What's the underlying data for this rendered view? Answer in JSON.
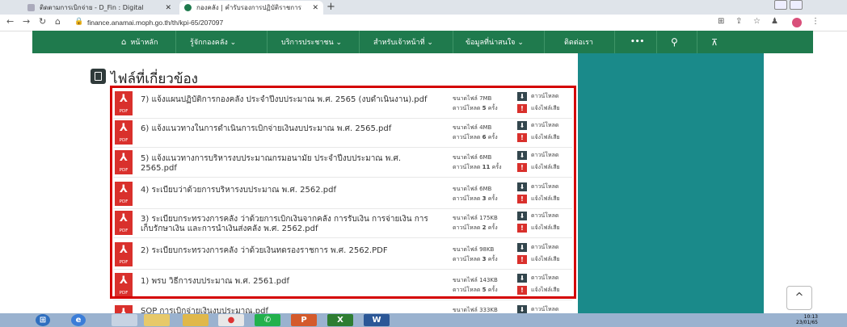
{
  "browser": {
    "tabs": [
      {
        "title": "ติดตามการเบิกจ่าย - D_Fin : Digital"
      },
      {
        "title": "กองคลัง | คำรับรองการปฏิบัติราชการ"
      }
    ],
    "new_tab": "+",
    "url": "finance.anamai.moph.go.th/th/kpi-65/207097"
  },
  "nav": {
    "items": [
      {
        "label": "หน้าหลัก",
        "icon": "home-icon"
      },
      {
        "label": "รู้จักกองคลัง ⌄"
      },
      {
        "label": "บริการประชาชน ⌄"
      },
      {
        "label": "สำหรับเจ้าหน้าที่ ⌄"
      },
      {
        "label": "ข้อมูลที่น่าสนใจ ⌄"
      },
      {
        "label": "ติดต่อเรา"
      }
    ],
    "more": "•••"
  },
  "section": {
    "title": "ไฟล์ที่เกี่ยวข้อง"
  },
  "file_labels": {
    "pdf": "PDF",
    "size_prefix": "ขนาดไฟล์",
    "downloads_prefix": "ดาวน์โหลด",
    "downloads_suffix": "ครั้ง",
    "download": "ดาวน์โหลด",
    "report": "แจ้งไฟล์เสีย"
  },
  "files": [
    {
      "title": "7) แจ้งแผนปฏิบัติการกองคลัง ประจำปีงบประมาณ พ.ศ. 2565 (งบดำเนินงาน).pdf",
      "size": "7MB",
      "downloads": "5"
    },
    {
      "title": "6) แจ้งแนวทางในการดำเนินการเบิกจ่ายเงินงบประมาณ พ.ศ. 2565.pdf",
      "size": "4MB",
      "downloads": "6"
    },
    {
      "title": "5) แจ้งแนวทางการบริหารงบประมาณกรมอนามัย ประจำปีงบประมาณ พ.ศ. 2565.pdf",
      "size": "6MB",
      "downloads": "11"
    },
    {
      "title": "4) ระเบียบว่าด้วยการบริหารงบประมาณ พ.ศ. 2562.pdf",
      "size": "6MB",
      "downloads": "3"
    },
    {
      "title": "3) ระเบียบกระทรวงการคลัง ว่าด้วยการเบิกเงินจากคลัง การรับเงิน การจ่ายเงิน การเก็บรักษาเงิน และการนำเงินส่งคลัง พ.ศ. 2562.pdf",
      "size": "175KB",
      "downloads": "2"
    },
    {
      "title": "2) ระเบียบกระทรวงการคลัง ว่าด้วยเงินทดรองราชการ พ.ศ. 2562.PDF",
      "size": "98KB",
      "downloads": "3"
    },
    {
      "title": "1) พรบ วิธีการงบประมาณ พ.ศ. 2561.pdf",
      "size": "143KB",
      "downloads": "5"
    },
    {
      "title": "SOP การเบิกจ่ายเงินงบประมาณ.pdf",
      "size": "333KB",
      "downloads": ""
    }
  ],
  "scroll_top": "^",
  "taskbar": {
    "clock_time": "10:13",
    "clock_date": "23/01/65"
  },
  "colors": {
    "navbar": "#1f7a4d",
    "teal_panel": "#1a8a8a",
    "highlight": "#d40000",
    "pdf_icon": "#d9302c"
  }
}
